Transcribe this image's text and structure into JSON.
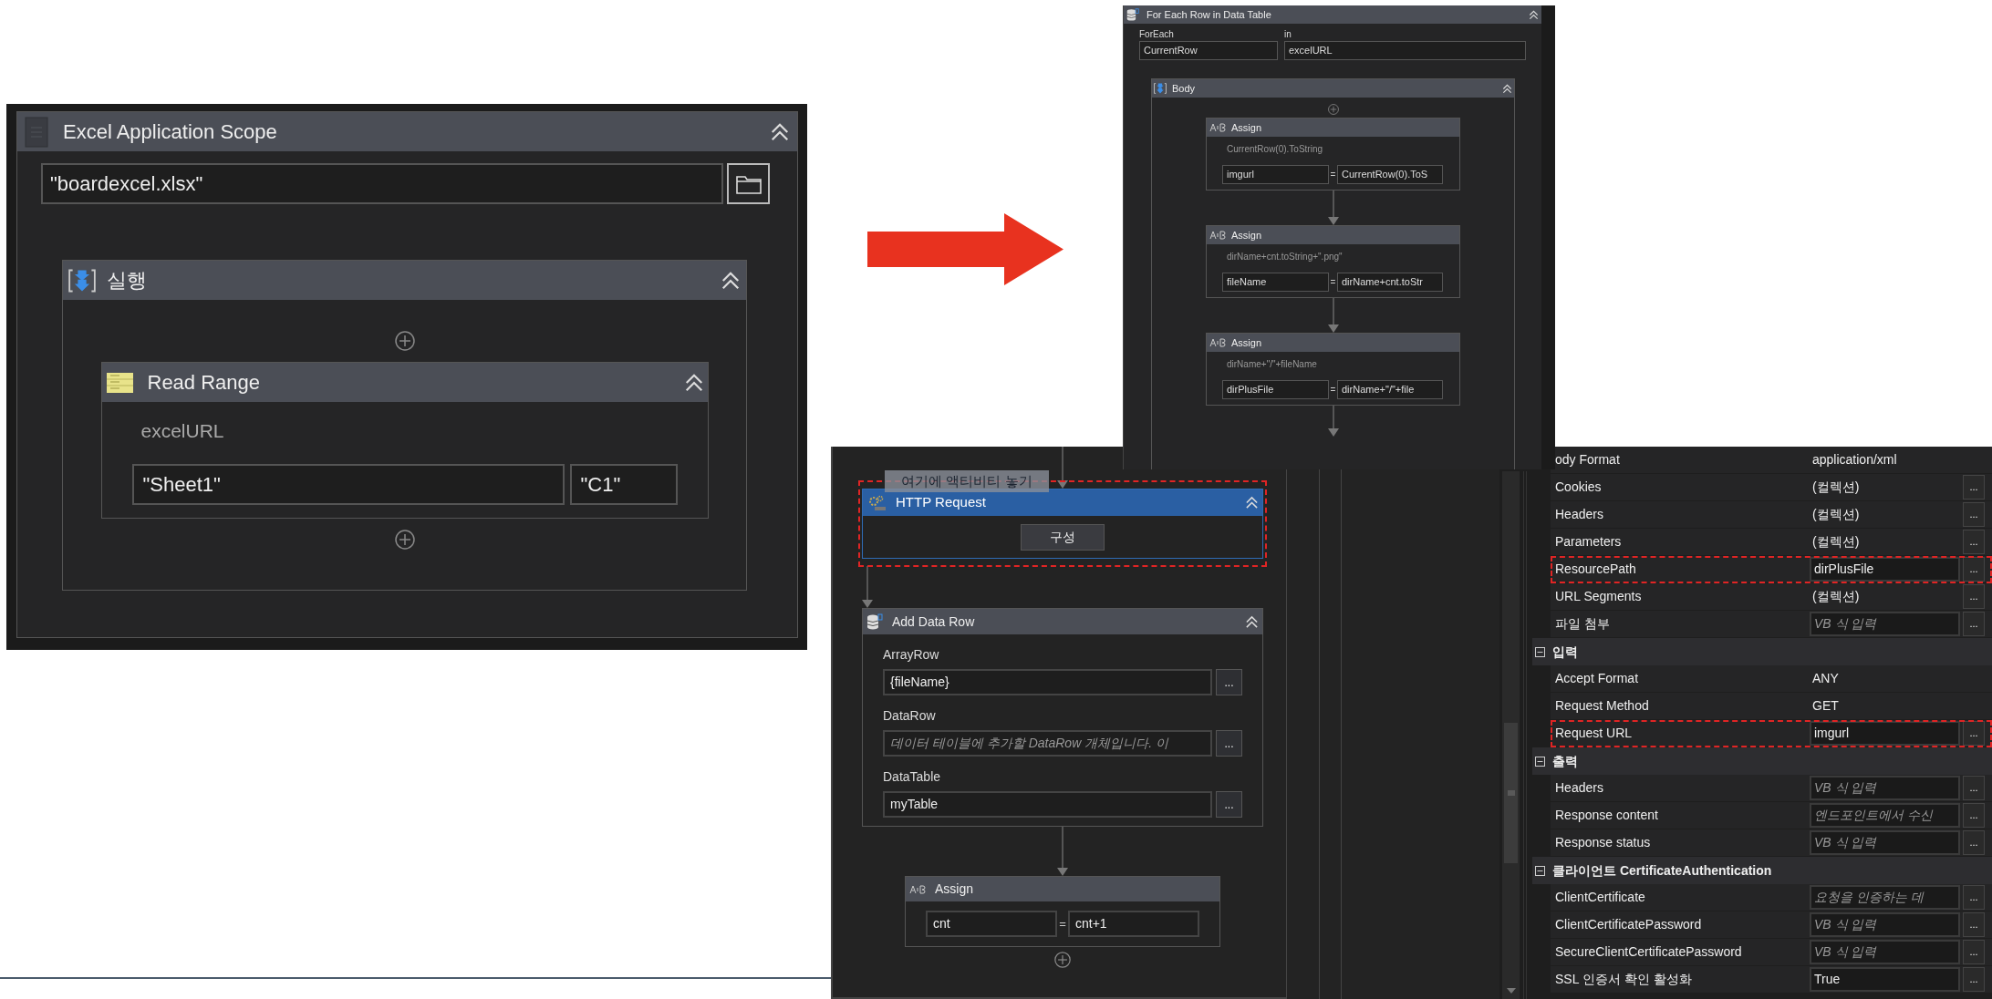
{
  "excel_scope": {
    "title": "Excel Application Scope",
    "file_path": "\"boardexcel.xlsx\"",
    "sequence": {
      "title": "실행",
      "read_range": {
        "title": "Read Range",
        "summary": "excelURL",
        "sheet": "\"Sheet1\"",
        "range": "\"C1\""
      }
    }
  },
  "for_each": {
    "title": "For Each Row in Data Table",
    "foreach_label": "ForEach",
    "foreach_value": "CurrentRow",
    "in_label": "in",
    "in_value": "excelURL",
    "body": {
      "title": "Body",
      "assigns": [
        {
          "title": "Assign",
          "summary": "CurrentRow(0).ToString",
          "to": "imgurl",
          "operator": "=",
          "value": "CurrentRow(0).ToS"
        },
        {
          "title": "Assign",
          "summary": "dirName+cnt.toString+\".png\"",
          "to": "fileName",
          "operator": "=",
          "value": "dirName+cnt.toStr"
        },
        {
          "title": "Assign",
          "summary": "dirName+\"/\"+fileName",
          "to": "dirPlusFile",
          "operator": "=",
          "value": "dirName+\"/\"+file"
        }
      ]
    }
  },
  "sequence": {
    "drop_hint": "여기에 액티비티 놓기",
    "http_request": {
      "title": "HTTP Request",
      "button": "구성",
      "selected": true,
      "highlighted": true
    },
    "add_data_row": {
      "title": "Add Data Row",
      "fields": [
        {
          "label": "ArrayRow",
          "value": "{fileName}",
          "button": "..."
        },
        {
          "label": "DataRow",
          "placeholder": "데이터 테이블에 추가할 DataRow 개체입니다. 이",
          "button": "..."
        },
        {
          "label": "DataTable",
          "value": "myTable",
          "button": "..."
        }
      ]
    },
    "assign": {
      "title": "Assign",
      "to": "cnt",
      "operator": "=",
      "value": "cnt+1"
    }
  },
  "properties": {
    "rows": [
      {
        "kind": "property",
        "label": "ody Format",
        "value": "application/xml",
        "boxed": false,
        "highlighted": false
      },
      {
        "kind": "property",
        "label": "Cookies",
        "value": "(컬렉션)",
        "boxed": false,
        "button": "...",
        "highlighted": false
      },
      {
        "kind": "property",
        "label": "Headers",
        "value": "(컬렉션)",
        "boxed": false,
        "button": "...",
        "highlighted": false
      },
      {
        "kind": "property",
        "label": "Parameters",
        "value": "(컬렉션)",
        "boxed": false,
        "button": "...",
        "highlighted": false
      },
      {
        "kind": "property",
        "label": "ResourcePath",
        "value": "dirPlusFile",
        "boxed": true,
        "button": "...",
        "highlighted": true
      },
      {
        "kind": "property",
        "label": "URL Segments",
        "value": "(컬렉션)",
        "boxed": false,
        "button": "...",
        "highlighted": false
      },
      {
        "kind": "property",
        "label": "파일 첨부",
        "placeholder": "VB 식 입력",
        "boxed": true,
        "button": "...",
        "highlighted": false
      },
      {
        "kind": "category",
        "label": "입력",
        "expanded": true
      },
      {
        "kind": "property",
        "label": "Accept Format",
        "value": "ANY",
        "boxed": false,
        "highlighted": false
      },
      {
        "kind": "property",
        "label": "Request Method",
        "value": "GET",
        "boxed": false,
        "highlighted": false
      },
      {
        "kind": "property",
        "label": "Request URL",
        "value": "imgurl",
        "boxed": true,
        "button": "...",
        "highlighted": true
      },
      {
        "kind": "category",
        "label": "출력",
        "expanded": true
      },
      {
        "kind": "property",
        "label": "Headers",
        "placeholder": "VB 식 입력",
        "boxed": true,
        "button": "...",
        "highlighted": false
      },
      {
        "kind": "property",
        "label": "Response content",
        "placeholder": "엔드포인트에서 수신",
        "boxed": true,
        "button": "...",
        "highlighted": false
      },
      {
        "kind": "property",
        "label": "Response status",
        "placeholder": "VB 식 입력",
        "boxed": true,
        "button": "...",
        "highlighted": false
      },
      {
        "kind": "category",
        "label": "클라이언트 CertificateAuthentication",
        "expanded": true
      },
      {
        "kind": "property",
        "label": "ClientCertificate",
        "placeholder": "요청을 인증하는 데",
        "boxed": true,
        "button": "...",
        "highlighted": false
      },
      {
        "kind": "property",
        "label": "ClientCertificatePassword",
        "placeholder": "VB 식 입력",
        "boxed": true,
        "button": "...",
        "highlighted": false
      },
      {
        "kind": "property",
        "label": "SecureClientCertificatePassword",
        "placeholder": "VB 식 입력",
        "boxed": true,
        "button": "...",
        "highlighted": false
      },
      {
        "kind": "property",
        "label": "SSL 인증서 확인 활성화",
        "value": "True",
        "boxed": true,
        "button": "...",
        "highlighted": false
      }
    ]
  }
}
